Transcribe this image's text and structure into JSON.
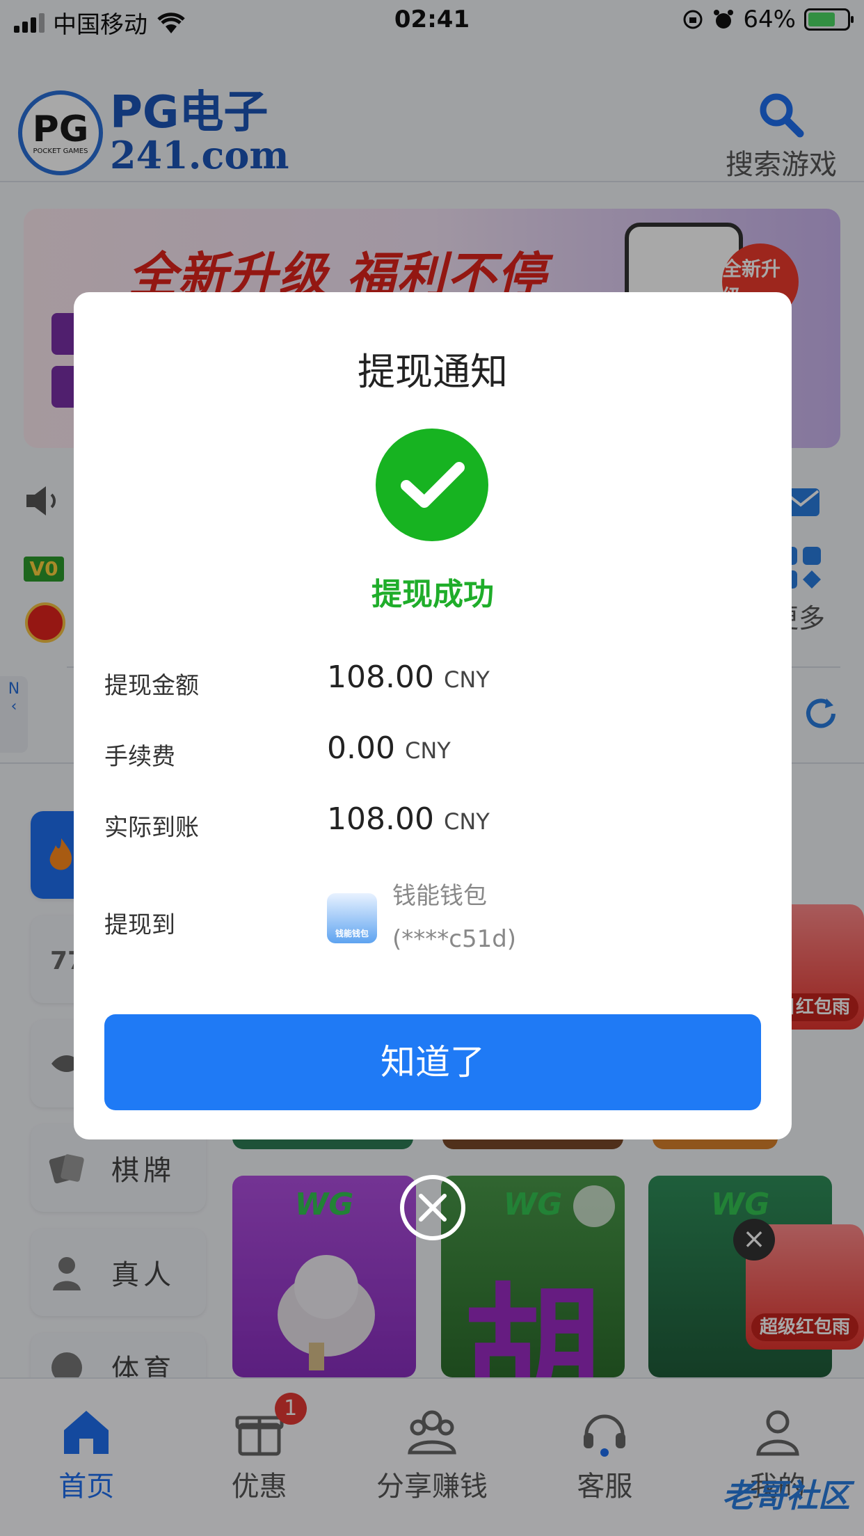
{
  "status_bar": {
    "carrier": "中国移动",
    "time": "02:41",
    "battery": "64%"
  },
  "header": {
    "logo_line1": "PG电子",
    "logo_line2": "241.com",
    "logo_badge_main": "PG",
    "logo_badge_sub": "POCKET GAMES",
    "search_label": "搜索游戏"
  },
  "banner": {
    "title": "全新升级 福利不停",
    "badge": "全新升级"
  },
  "info": {
    "vip": "V0",
    "more_label": "更多",
    "side_tab": "N"
  },
  "categories": [
    {
      "label": "棋牌",
      "icon": "cards-icon"
    },
    {
      "label": "真人",
      "icon": "person-icon"
    },
    {
      "label": "体育",
      "icon": "soccer-icon"
    }
  ],
  "games": [
    {
      "brand": "WG",
      "name": ""
    },
    {
      "brand": "WG",
      "char": "胡"
    },
    {
      "brand": "WG",
      "name": ""
    }
  ],
  "promos": {
    "daily": "每日红包雨",
    "super": "超级红包雨"
  },
  "bottom_nav": [
    {
      "label": "首页",
      "icon": "home-icon",
      "active": true
    },
    {
      "label": "优惠",
      "icon": "gift-icon",
      "badge": "1"
    },
    {
      "label": "分享赚钱",
      "icon": "share-icon"
    },
    {
      "label": "客服",
      "icon": "headset-icon"
    },
    {
      "label": "我的",
      "icon": "user-icon"
    }
  ],
  "watermark": "老哥社区",
  "modal": {
    "title": "提现通知",
    "status": "提现成功",
    "rows": [
      {
        "label": "提现金额",
        "value": "108.00",
        "currency": "CNY"
      },
      {
        "label": "手续费",
        "value": "0.00",
        "currency": "CNY"
      },
      {
        "label": "实际到账",
        "value": "108.00",
        "currency": "CNY"
      }
    ],
    "dest_label": "提现到",
    "wallet_name": "钱能钱包",
    "wallet_account": "(****c51d)",
    "wallet_icon_text": "钱能钱包",
    "button": "知道了"
  },
  "colors": {
    "primary": "#1f7af5",
    "success": "#17b321",
    "overlay": "rgba(0,0,0,0.34)"
  }
}
